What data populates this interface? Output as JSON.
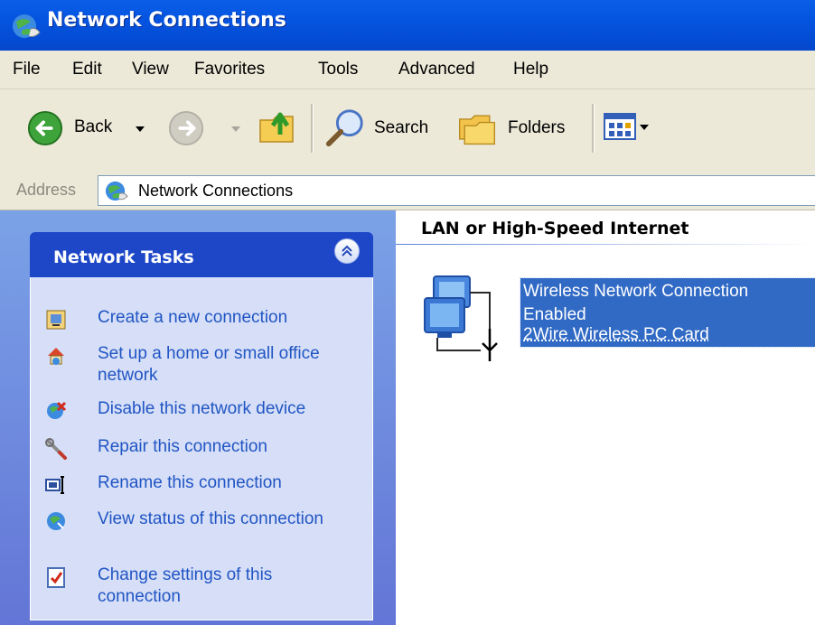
{
  "window": {
    "title": "Network Connections"
  },
  "menubar": {
    "items": [
      "File",
      "Edit",
      "View",
      "Favorites",
      "Tools",
      "Advanced",
      "Help"
    ]
  },
  "toolbar": {
    "back_label": "Back",
    "search_label": "Search",
    "folders_label": "Folders"
  },
  "address": {
    "label": "Address",
    "value": "Network Connections"
  },
  "tasks": {
    "title": "Network Tasks",
    "items": [
      {
        "label": "Create a new connection",
        "icon": "new-connection-icon"
      },
      {
        "label": "Set up a home or small office network",
        "icon": "home-network-icon"
      },
      {
        "label": "Disable this network device",
        "icon": "disable-device-icon"
      },
      {
        "label": "Repair this connection",
        "icon": "repair-icon"
      },
      {
        "label": "Rename this connection",
        "icon": "rename-icon"
      },
      {
        "label": "View status of this connection",
        "icon": "status-icon"
      },
      {
        "label": "Change settings of this connection",
        "icon": "settings-icon"
      }
    ]
  },
  "content": {
    "group_header": "LAN or High-Speed Internet",
    "connection": {
      "name": "Wireless Network Connection",
      "status": "Enabled",
      "device": "2Wire Wireless PC Card"
    }
  },
  "colors": {
    "title_bar": "#0554e0",
    "task_header": "#1d47c7",
    "task_link": "#2155c4",
    "selection": "#316ac5",
    "chrome": "#ece9d8"
  }
}
